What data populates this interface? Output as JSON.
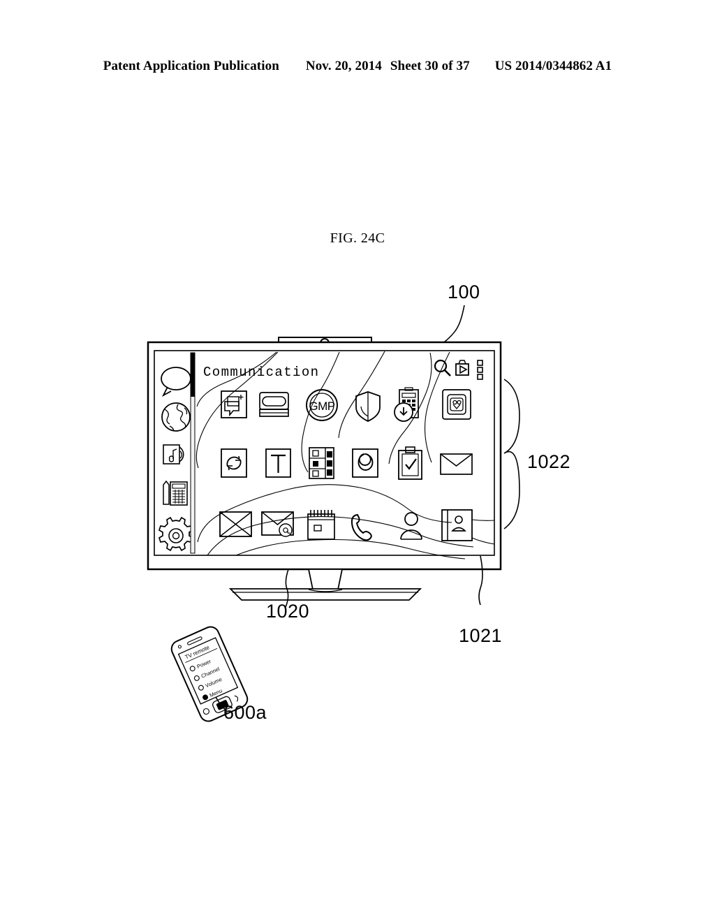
{
  "document": {
    "header": {
      "publication_type": "Patent Application Publication",
      "date": "Nov. 20, 2014",
      "sheet": "Sheet 30 of 37",
      "patent_number": "US 2014/0344862 A1"
    },
    "figure_title": "FIG. 24C"
  },
  "reference_numerals": {
    "display_device": "100",
    "sidebar_region": "1020",
    "pointer_region": "1021",
    "app_grid_region": "1022",
    "mobile_device": "600a"
  },
  "tv": {
    "screen_title": "Communication",
    "toolbar": [
      {
        "name": "search-icon",
        "label": "Search"
      },
      {
        "name": "media-store-icon",
        "label": "Media Store"
      },
      {
        "name": "list-menu-icon",
        "label": "Menu"
      }
    ],
    "sidebar_items": [
      {
        "name": "sidebar-item-communication",
        "icon": "speech-bubble-icon",
        "label": "Communication"
      },
      {
        "name": "sidebar-item-internet",
        "icon": "globe-icon",
        "label": "Internet"
      },
      {
        "name": "sidebar-item-media",
        "icon": "music-media-icon",
        "label": "Media"
      },
      {
        "name": "sidebar-item-tools",
        "icon": "calculator-pencil-icon",
        "label": "Tools"
      },
      {
        "name": "sidebar-item-settings",
        "icon": "gear-icon",
        "label": "Settings"
      }
    ],
    "app_grid": {
      "rows": 3,
      "columns": 6,
      "apps": [
        {
          "name": "app-messages",
          "icon": "chat-add-icon",
          "label": "Messages"
        },
        {
          "name": "app-keyboard",
          "icon": "rounded-tray-icon",
          "label": "Keyboard"
        },
        {
          "name": "app-gmp",
          "icon": "gmp-circle-icon",
          "label": "GMP"
        },
        {
          "name": "app-security",
          "icon": "shield-icon",
          "label": "Security"
        },
        {
          "name": "app-downloads",
          "icon": "calculator-download-icon",
          "label": "Downloads"
        },
        {
          "name": "app-wearable",
          "icon": "watch-device-icon",
          "label": "Wearable"
        },
        {
          "name": "app-sync",
          "icon": "sync-refresh-icon",
          "label": "Sync"
        },
        {
          "name": "app-text",
          "icon": "letter-t-icon",
          "label": "Text"
        },
        {
          "name": "app-tasklist",
          "icon": "checklist-icon",
          "label": "Task List"
        },
        {
          "name": "app-google",
          "icon": "letter-g-icon",
          "label": "Search Engine"
        },
        {
          "name": "app-clipboard",
          "icon": "clipboard-check-icon",
          "label": "Notes"
        },
        {
          "name": "app-mail2",
          "icon": "envelope-icon",
          "label": "Mail"
        },
        {
          "name": "app-mail-x",
          "icon": "envelope-cross-icon",
          "label": "Mail"
        },
        {
          "name": "app-email-at",
          "icon": "envelope-at-icon",
          "label": "Email"
        },
        {
          "name": "app-notepad",
          "icon": "notepad-icon",
          "label": "Notepad"
        },
        {
          "name": "app-phone",
          "icon": "phone-handset-icon",
          "label": "Phone"
        },
        {
          "name": "app-contact",
          "icon": "person-icon",
          "label": "Contact"
        },
        {
          "name": "app-addressbook",
          "icon": "address-book-icon",
          "label": "Address Book"
        }
      ]
    }
  },
  "mobile": {
    "screen_title": "TV remote",
    "options": [
      {
        "label": "Power",
        "selected": false
      },
      {
        "label": "Channel",
        "selected": false
      },
      {
        "label": "Volume",
        "selected": false
      },
      {
        "label": "Menu",
        "selected": true
      }
    ]
  },
  "colors": {
    "line": "#000000",
    "paper": "#ffffff",
    "scrollbar_thumb": "#000000",
    "scrollbar_track": "#f2f2f2"
  }
}
